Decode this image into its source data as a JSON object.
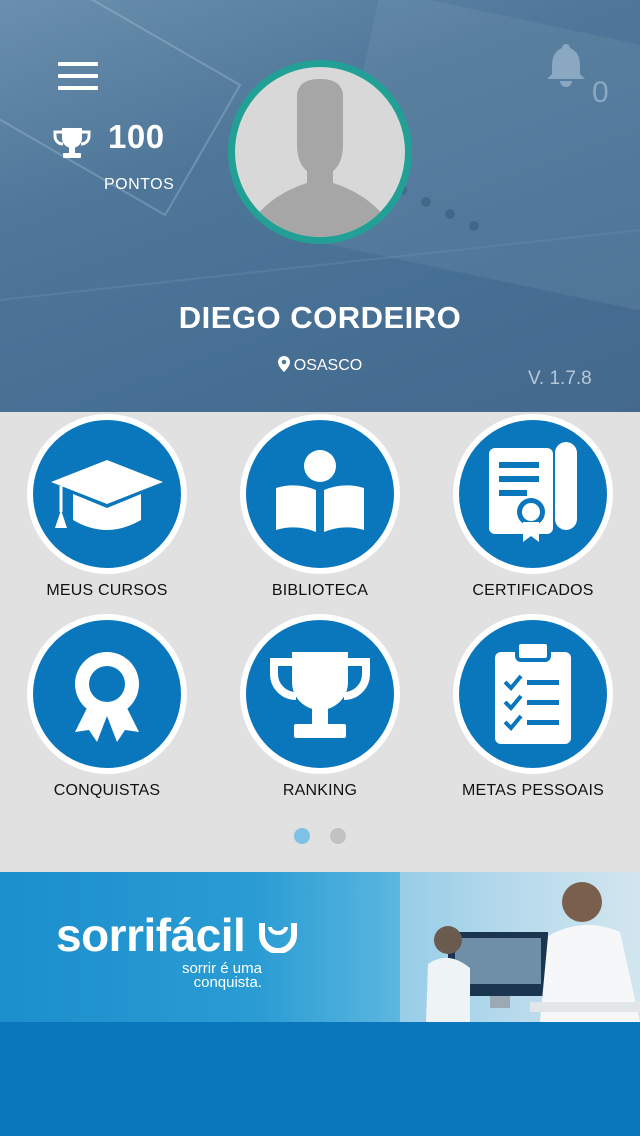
{
  "header": {
    "points_value": "100",
    "points_label": "PONTOS",
    "notification_count": "0",
    "user_name": "DIEGO CORDEIRO",
    "location": "OSASCO",
    "version": "V. 1.7.8"
  },
  "menu": [
    {
      "label": "MEUS CURSOS",
      "icon": "graduation-cap-icon"
    },
    {
      "label": "BIBLIOTECA",
      "icon": "reader-book-icon"
    },
    {
      "label": "CERTIFICADOS",
      "icon": "certificate-icon"
    },
    {
      "label": "CONQUISTAS",
      "icon": "award-ribbon-icon"
    },
    {
      "label": "RANKING",
      "icon": "trophy-icon"
    },
    {
      "label": "METAS PESSOAIS",
      "icon": "checklist-clipboard-icon"
    }
  ],
  "pager": {
    "pages": 2,
    "active": 1
  },
  "banner": {
    "brand": "sorrifácil",
    "slogan_line1": "sorrir é uma",
    "slogan_line2": "conquista."
  },
  "colors": {
    "primary": "#0a77bd",
    "avatar_ring": "#22a096",
    "grid_bg": "#e1e1e1",
    "dot_active": "#7fc1e6"
  }
}
